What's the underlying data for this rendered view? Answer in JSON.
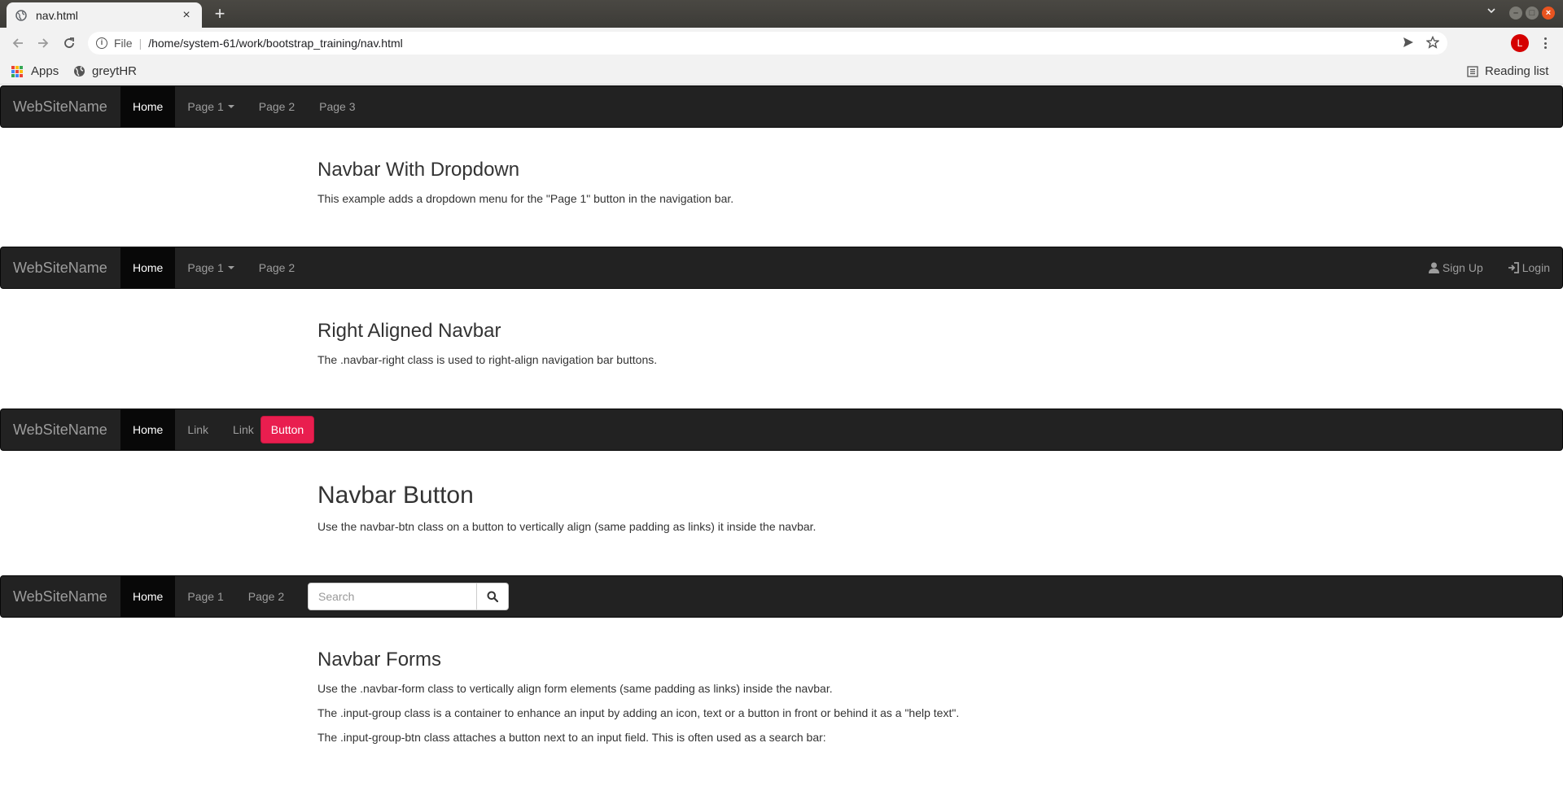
{
  "browser": {
    "tab_title": "nav.html",
    "tab_close": "×",
    "new_tab": "+",
    "url_scheme": "File",
    "url_separator": "|",
    "url": "/home/system-61/work/bootstrap_training/nav.html",
    "profile_initial": "L",
    "bookmarks": [
      {
        "label": "Apps",
        "icon": "apps-grid-icon"
      },
      {
        "label": "greytHR",
        "icon": "globe-icon"
      }
    ],
    "reading_list": "Reading list"
  },
  "navbars": [
    {
      "brand": "WebSiteName",
      "items": [
        {
          "label": "Home",
          "active": true
        },
        {
          "label": "Page 1",
          "dropdown": true
        },
        {
          "label": "Page 2"
        },
        {
          "label": "Page 3"
        }
      ]
    },
    {
      "brand": "WebSiteName",
      "items": [
        {
          "label": "Home",
          "active": true
        },
        {
          "label": "Page 1",
          "dropdown": true
        },
        {
          "label": "Page 2"
        }
      ],
      "right_items": [
        {
          "label": "Sign Up",
          "icon": "user-icon"
        },
        {
          "label": "Login",
          "icon": "login-icon"
        }
      ]
    },
    {
      "brand": "WebSiteName",
      "items": [
        {
          "label": "Home",
          "active": true
        },
        {
          "label": "Link"
        },
        {
          "label": "Link"
        }
      ],
      "button": {
        "label": "Button",
        "color": "#e91e4f"
      }
    },
    {
      "brand": "WebSiteName",
      "items": [
        {
          "label": "Home",
          "active": true
        },
        {
          "label": "Page 1"
        },
        {
          "label": "Page 2"
        }
      ],
      "search": {
        "placeholder": "Search",
        "icon": "search-icon"
      }
    }
  ],
  "sections": [
    {
      "heading": "Navbar With Dropdown",
      "paragraphs": [
        "This example adds a dropdown menu for the \"Page 1\" button in the navigation bar."
      ]
    },
    {
      "heading": "Right Aligned Navbar",
      "paragraphs": [
        "The .navbar-right class is used to right-align navigation bar buttons."
      ]
    },
    {
      "heading": "Navbar Button",
      "paragraphs": [
        "Use the navbar-btn class on a button to vertically align (same padding as links) it inside the navbar."
      ]
    },
    {
      "heading": "Navbar Forms",
      "paragraphs": [
        "Use the .navbar-form class to vertically align form elements (same padding as links) inside the navbar.",
        "The .input-group class is a container to enhance an input by adding an icon, text or a button in front or behind it as a \"help text\".",
        "The .input-group-btn class attaches a button next to an input field. This is often used as a search bar:"
      ]
    }
  ],
  "colors": {
    "navbar_bg": "#222222",
    "navbar_active": "#080808",
    "navbar_text": "#9d9d9d",
    "accent_button": "#e91e4f"
  }
}
